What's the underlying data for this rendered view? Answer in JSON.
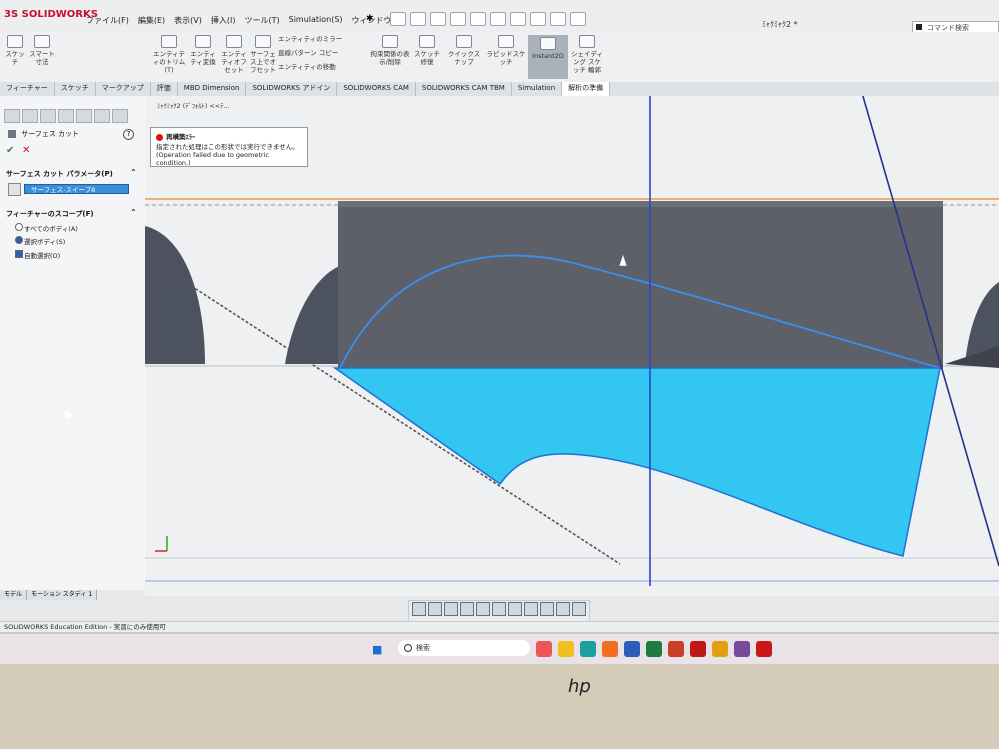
{
  "app": {
    "logo": "3S SOLIDWORKS",
    "menus": [
      "ファイル(F)",
      "編集(E)",
      "表示(V)",
      "挿入(I)",
      "ツール(T)",
      "Simulation(S)",
      "ウィンドウ(W)"
    ],
    "doc_title": "ﾐｬｸﾐｬｸ2 *",
    "command_search": "コマンド検索"
  },
  "ribbon": [
    {
      "label": "スケッチ"
    },
    {
      "label": "スマート寸法"
    },
    {
      "label": "エンティティのトリム(T)"
    },
    {
      "label": "エンティティ変換"
    },
    {
      "label": "エンティティオフセット"
    },
    {
      "label": "サーフェス上でオフセット"
    },
    {
      "label": "エンティティのミラー"
    },
    {
      "label": "直線パターン コピー"
    },
    {
      "label": "エンティティの移動"
    },
    {
      "label": "拘束関係の表示/削除"
    },
    {
      "label": "スケッチ修復"
    },
    {
      "label": "クイックスナップ"
    },
    {
      "label": "ラピッドスケッチ"
    },
    {
      "label": "Instant2D"
    },
    {
      "label": "シェイディング スケッチ 輪郭"
    }
  ],
  "command_tabs": [
    "フィーチャー",
    "スケッチ",
    "マークアップ",
    "評価",
    "MBD Dimension",
    "SOLIDWORKS アドイン",
    "SOLIDWORKS CAM",
    "SOLIDWORKS CAM TBM",
    "Simulation",
    "解析の準備"
  ],
  "property_manager": {
    "title": "サーフェス カット",
    "params_header": "サーフェス カット パラメータ(P)",
    "selected_surface": "サーフェス-スイープ8",
    "scope_header": "フィーチャーのスコープ(F)",
    "options": [
      "すべてのボディ(A)",
      "選択ボディ(S)",
      "自動選択(O)"
    ]
  },
  "viewport": {
    "breadcrumb": "ﾐｬｸﾐｬｸ2 (ﾃﾞﾌｫﾙﾄ) <<ﾃ...",
    "error_title": "再構築ｴﾗｰ",
    "error_line1": "指定された処理はこの形状では実行できません。",
    "error_line2": "(Operation failed due to geometric condition.)"
  },
  "model_tabs": [
    "モデル",
    "モーション スタディ 1"
  ],
  "status_bar": "SOLIDWORKS Education Edition - 実習にのみ使用可",
  "taskbar": {
    "search": "検索"
  },
  "colors": {
    "surface": "#33c6f0",
    "block": "#5d6068",
    "edge": "#1f6fd6"
  }
}
